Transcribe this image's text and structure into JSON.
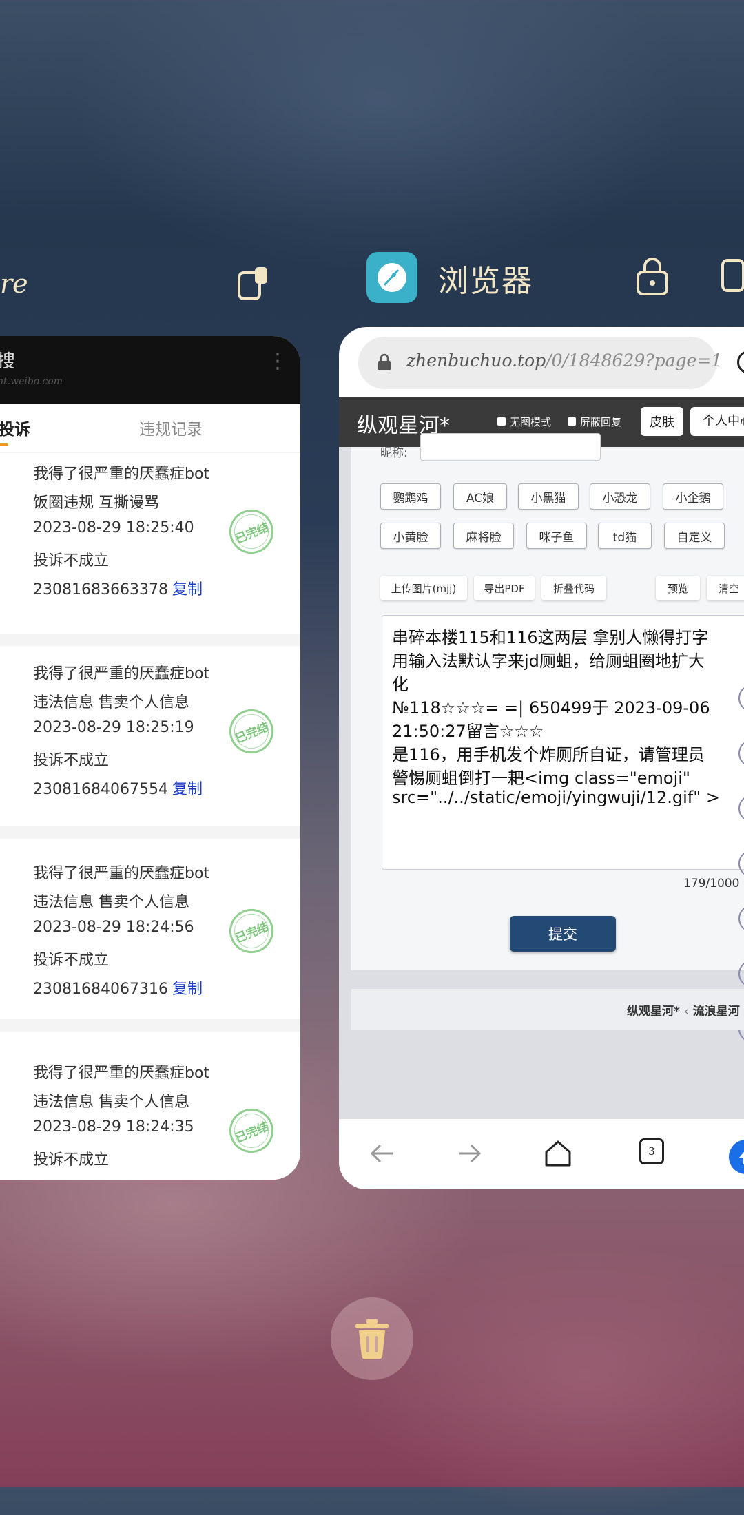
{
  "left_app": {
    "name": "re",
    "topbar_title": "搜",
    "topbar_subtitle": "nt.weibo.com",
    "tabs": {
      "active": "投诉",
      "other": "违规记录"
    },
    "copy_label": "复制",
    "stamp_text": "已完结",
    "items": [
      {
        "title": "我得了很严重的厌蠢症bot",
        "reason": "饭圈违规 互撕谩骂",
        "time": "2023-08-29 18:25:40",
        "status": "投诉不成立",
        "id": "23081683663378"
      },
      {
        "title": "我得了很严重的厌蠢症bot",
        "reason": "违法信息 售卖个人信息",
        "time": "2023-08-29 18:25:19",
        "status": "投诉不成立",
        "id": "23081684067554"
      },
      {
        "title": "我得了很严重的厌蠢症bot",
        "reason": "违法信息 售卖个人信息",
        "time": "2023-08-29 18:24:56",
        "status": "投诉不成立",
        "id": "23081684067316"
      },
      {
        "title": "我得了很严重的厌蠢症bot",
        "reason": "违法信息 售卖个人信息",
        "time": "2023-08-29 18:24:35",
        "status": "投诉不成立",
        "id": ""
      }
    ]
  },
  "browser_app": {
    "name": "浏览器",
    "url_host": "zhenbuchuo.top",
    "url_path": "/0/1848629?page=1",
    "site_title": "纵观星河*",
    "checkbox_no_image": "无图模式",
    "checkbox_block_reply": "屏蔽回复",
    "skin_button": "皮肤",
    "personal_button": "个人中心",
    "nick_label": "昵称:",
    "emoji_row1": [
      "鹦鹉鸡",
      "AC娘",
      "小黑猫",
      "小恐龙",
      "小企鹅"
    ],
    "emoji_row2": [
      "小黄脸",
      "麻将脸",
      "咪子鱼",
      "td猫",
      "自定义"
    ],
    "tools": [
      "上传图片(mjj)",
      "导出PDF",
      "折叠代码",
      "预览",
      "清空"
    ],
    "textarea_lines": [
      "串碎本楼115和116这两层 拿别人懒得打字",
      "用输入法默认字来jd厕蛆，给厕蛆圈地扩大",
      "化",
      "№118☆☆☆= =| 650499于 2023-09-06",
      "21:50:27留言☆☆☆",
      "是116，用手机发个炸厕所自证，请管理员",
      "警惕厕蛆倒打一耙<img class=\"emoji\"",
      "src=\"../../static/emoji/yingwuji/12.gif\" >"
    ],
    "char_counter": "179/1000",
    "submit_button": "提交",
    "breadcrumb": [
      "纵观星河*",
      "流浪星河"
    ],
    "tab_count": "3"
  },
  "colors": {
    "stamp_green": "#7cc67c",
    "link_blue": "#1a3cc9",
    "submit_blue": "#234a74",
    "tab_accent": "#f29a1f",
    "browser_icon": "#3ab0c9"
  }
}
